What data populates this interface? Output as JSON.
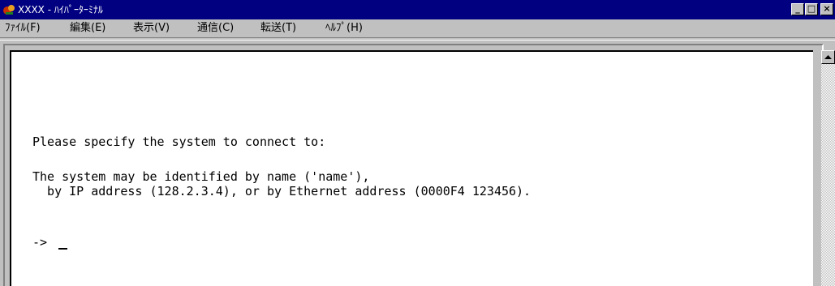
{
  "window": {
    "title": "XXXX - ﾊｲﾊﾟｰﾀｰﾐﾅﾙ",
    "titlebar_color": "#000080",
    "min_label": "_",
    "max_label": "□",
    "close_label": "×"
  },
  "menu": {
    "items": [
      {
        "label": "ﾌｧｲﾙ(F)"
      },
      {
        "label": "編集(E)"
      },
      {
        "label": "表示(V)"
      },
      {
        "label": "通信(C)"
      },
      {
        "label": "転送(T)"
      },
      {
        "label": "ﾍﾙﾌﾟ(H)"
      }
    ]
  },
  "terminal": {
    "lines": [
      "Please specify the system to connect to:",
      "The system may be identified by name ('name'),",
      "  by IP address (128.2.3.4), or by Ethernet address (0000F4 123456).",
      "-> "
    ]
  }
}
